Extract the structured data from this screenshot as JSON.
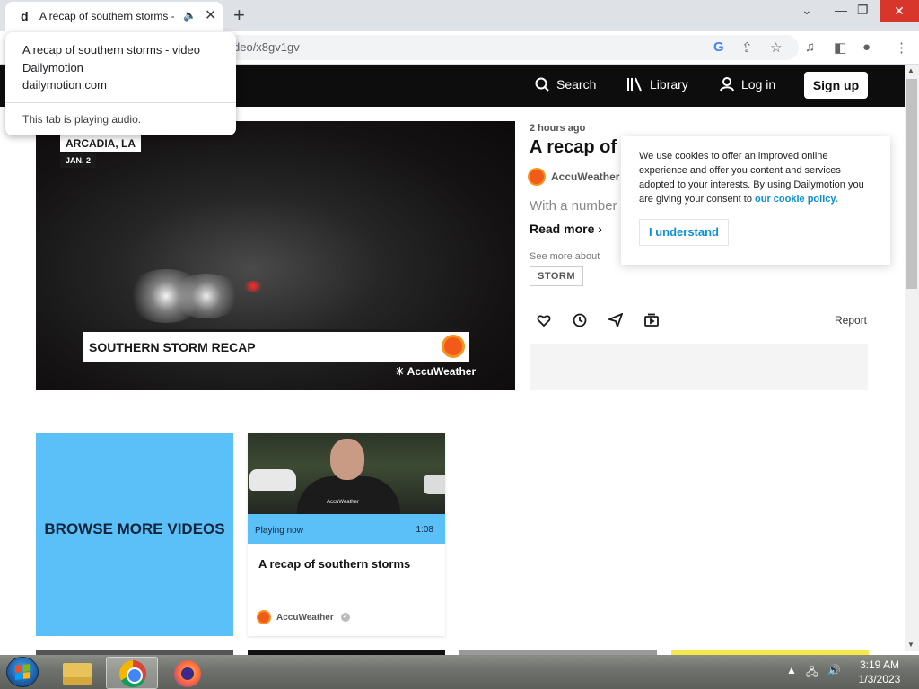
{
  "browser": {
    "tab_favicon": "d",
    "tab_title": "A recap of southern storms - video Dailymotion",
    "url_partial": "deo/x8gv1gv",
    "icons": [
      "audio-icon",
      "close-icon",
      "new-tab-icon",
      "google-icon",
      "share-icon",
      "star-icon",
      "media-icon",
      "sidebar-icon",
      "profile-icon",
      "menu-icon"
    ]
  },
  "popup": {
    "title": "A recap of southern storms - video Dailymotion",
    "domain": "dailymotion.com",
    "audio_note": "This tab is playing audio."
  },
  "header": {
    "search": "Search",
    "library": "Library",
    "login": "Log in",
    "signup": "Sign up"
  },
  "video": {
    "location_tag": "ARCADIA, LA",
    "date_tag": "JAN. 2",
    "lower_third": "SOUTHERN STORM RECAP",
    "watermark": "AccuWeather"
  },
  "info": {
    "posted": "2 hours ago",
    "title": "A recap of southern storms",
    "channel": "AccuWeather",
    "description": "With a number",
    "read_more": "Read more",
    "see_more": "See more about",
    "tag": "STORM",
    "report": "Report",
    "actions": [
      "heart-icon",
      "clock-icon",
      "share-icon",
      "playlist-icon"
    ]
  },
  "cookie": {
    "text": "We use cookies to offer an improved online experience and offer you content and services adopted to your interests. By using Dailymotion you are giving your consent to ",
    "link": "our cookie policy.",
    "button": "I understand"
  },
  "cards": {
    "browse": "BROWSE MORE VIDEOS",
    "video_card": {
      "shirt_text": "AccuWeather",
      "status": "Playing now",
      "duration": "1:08",
      "title": "A recap of southern storms",
      "channel": "AccuWeather"
    }
  },
  "taskbar": {
    "time": "3:19 AM",
    "date": "1/3/2023"
  },
  "colors": {
    "accent_blue": "#5bc0f7",
    "link_blue": "#0a8fd6",
    "header_bg": "#0d0d0d",
    "accuweather_orange": "#f05a1a"
  }
}
